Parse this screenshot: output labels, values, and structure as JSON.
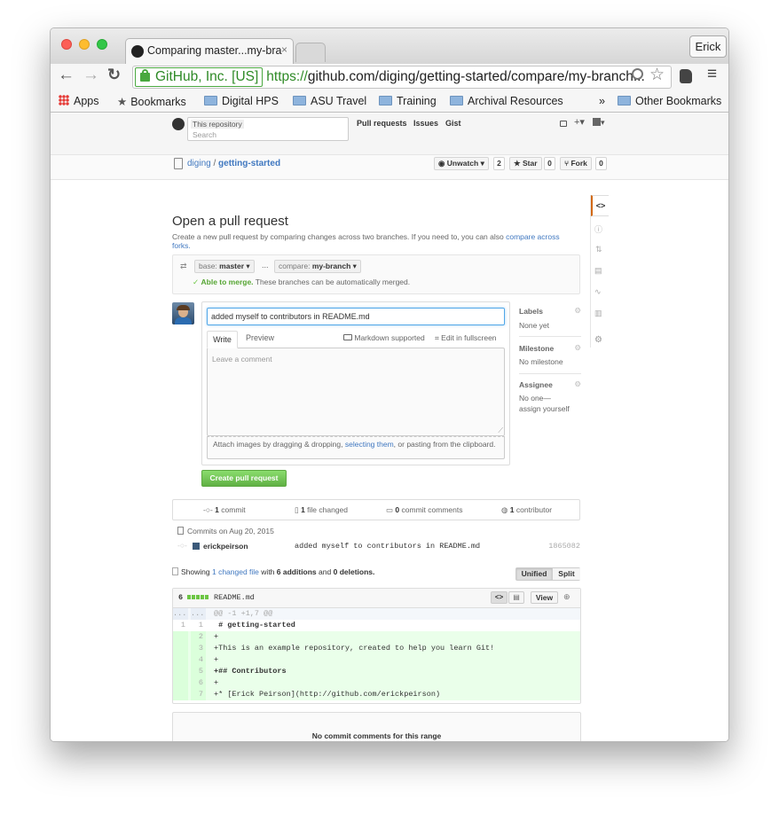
{
  "browser": {
    "tab_title": "Comparing master...my-bra",
    "user": "Erick",
    "ev_label": "GitHub, Inc. [US]",
    "url_scheme": "https://",
    "url_rest": "github.com/diging/getting-started/compare/my-branch...",
    "bookmarks": [
      "Apps",
      "Bookmarks",
      "Digital HPS",
      "ASU Travel",
      "Training",
      "Archival Resources"
    ],
    "overflow": "»",
    "other_bookmarks": "Other Bookmarks"
  },
  "header": {
    "search_scope": "This repository",
    "search_placeholder": "Search",
    "nav": [
      "Pull requests",
      "Issues",
      "Gist"
    ]
  },
  "repo": {
    "owner": "diging",
    "sep": "/",
    "name": "getting-started",
    "unwatch_label": "Unwatch",
    "unwatch_count": "2",
    "star_label": "Star",
    "star_count": "0",
    "fork_label": "Fork",
    "fork_count": "0"
  },
  "pr": {
    "title": "Open a pull request",
    "desc": "Create a new pull request by comparing changes across two branches. If you need to, you can also",
    "desc_link": "compare across forks.",
    "base_prefix": "base:",
    "base_branch": "master",
    "compare_prefix": "compare:",
    "compare_branch": "my-branch",
    "dots": "...",
    "merge_ok": "Able to merge.",
    "merge_text": "These branches can be automatically merged.",
    "title_value": "added myself to contributors in README.md",
    "tab_write": "Write",
    "tab_preview": "Preview",
    "markdown": "Markdown supported",
    "fullscreen": "Edit in fullscreen",
    "comment_placeholder": "Leave a comment",
    "attach_1": "Attach images by dragging & dropping,",
    "attach_link": "selecting them",
    "attach_2": ", or pasting from the clipboard.",
    "create_button": "Create pull request"
  },
  "sidebar": {
    "labels_title": "Labels",
    "labels_value": "None yet",
    "milestone_title": "Milestone",
    "milestone_value": "No milestone",
    "assignee_title": "Assignee",
    "assignee_value_1": "No one—",
    "assignee_value_2": "assign yourself"
  },
  "summary": {
    "commits": "1",
    "commits_label": "commit",
    "files": "1",
    "files_label": "file changed",
    "comments": "0",
    "comments_label": "commit comments",
    "contributors": "1",
    "contributors_label": "contributor"
  },
  "commits": {
    "date_header": "Commits on Aug 20, 2015",
    "author": "erickpeirson",
    "message": "added myself to contributors in README.md",
    "sha": "1865082"
  },
  "showing": {
    "prefix": "Showing",
    "link": "1 changed file",
    "mid": "with",
    "additions": "6 additions",
    "and": "and",
    "deletions": "0 deletions.",
    "unified": "Unified",
    "split": "Split"
  },
  "file": {
    "count": "6",
    "name": "README.md",
    "view": "View",
    "hunk_marker": "...",
    "hunk": "@@ -1 +1,7 @@",
    "lines": [
      {
        "old": "1",
        "new": "1",
        "text": " # getting-started",
        "added": false
      },
      {
        "old": "",
        "new": "2",
        "text": "+",
        "added": true
      },
      {
        "old": "",
        "new": "3",
        "text": "+This is an example repository, created to help you learn Git!",
        "added": true
      },
      {
        "old": "",
        "new": "4",
        "text": "+",
        "added": true
      },
      {
        "old": "",
        "new": "5",
        "text": "+## Contributors",
        "added": true
      },
      {
        "old": "",
        "new": "6",
        "text": "+",
        "added": true
      },
      {
        "old": "",
        "new": "7",
        "text": "+* [Erick Peirson](http://github.com/erickpeirson)",
        "added": true
      }
    ]
  },
  "no_comments": "No commit comments for this range",
  "colors": {
    "accent": "#4078c0",
    "green_button": "#6cc644",
    "added_bg": "#eaffea",
    "added_num_bg": "#dbffdb",
    "arrow": "#f7941d"
  }
}
